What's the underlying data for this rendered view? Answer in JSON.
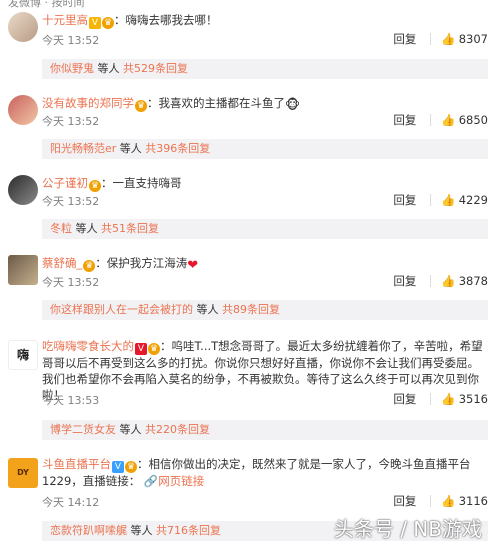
{
  "top_cut_text": "发微博 · 按时间",
  "comments": [
    {
      "user": "十元里高",
      "badges": [
        "V",
        "👑"
      ],
      "text": "：嗨嗨去哪我去哪！",
      "emoji": "",
      "time": "今天 13:52",
      "reply": "回复",
      "likes": "8307",
      "sub": {
        "name": "你似野鬼",
        "rest": "等人",
        "count": "共529条回复"
      }
    },
    {
      "user": "没有故事的郑同学",
      "badges": [
        "lvl"
      ],
      "text": "：我喜欢的主播都在斗鱼了",
      "emoji": "🐵",
      "time": "今天 13:52",
      "reply": "回复",
      "likes": "6850",
      "sub": {
        "name": "阳光畅畅范er",
        "rest": "等人",
        "count": "共396条回复"
      }
    },
    {
      "user": "公子谨初",
      "badges": [
        "lvl"
      ],
      "text": "：一直支持嗨哥",
      "emoji": "",
      "time": "今天 13:52",
      "reply": "回复",
      "likes": "4229",
      "sub": {
        "name": "冬粒",
        "rest": "等人",
        "count": "共51条回复"
      }
    },
    {
      "user": "蔡舒确_",
      "badges": [
        "lvl"
      ],
      "text": "：保护我方江海涛",
      "emoji": "❤",
      "time": "今天 13:52",
      "reply": "回复",
      "likes": "3878",
      "sub": {
        "name": "你这样跟别人在一起会被打的",
        "rest": "等人",
        "count": "共89条回复"
      }
    },
    {
      "user": "吃嗨嗨零食长大的",
      "badges": [
        "red",
        "lvl"
      ],
      "text": "：呜哇T...T想念哥哥了。最近太多纷扰缠着你了，辛苦啦，希望哥哥以后不再受到这么多的打扰。你说你只想好好直播，你说你不会让我们再受委屈。我们也希望你不会再陷入莫名的纷争，不再被欺负。等待了这么久终于可以再次见到你啦！",
      "emoji": "",
      "time": "今天 13:53",
      "reply": "回复",
      "likes": "3516",
      "sub": {
        "name": "博学二货女友",
        "rest": "等人",
        "count": "共220条回复"
      }
    },
    {
      "user": "斗鱼直播平台",
      "badges": [
        "blue",
        "lvl"
      ],
      "text": "：相信你做出的决定，既然来了就是一家人了，今晚斗鱼直播平台1229，直播链接：",
      "emoji": "",
      "link": "网页链接",
      "time": "今天 14:12",
      "reply": "回复",
      "likes": "3116",
      "sub": {
        "name": "恋款符趴啊嗦艉",
        "rest": "等人",
        "count": "共716条回复"
      }
    }
  ],
  "watermark": "头条号 / NB游戏",
  "colors": {
    "accent": "#eb7350",
    "subbox": "#f2f2f5",
    "time": "#808080"
  }
}
